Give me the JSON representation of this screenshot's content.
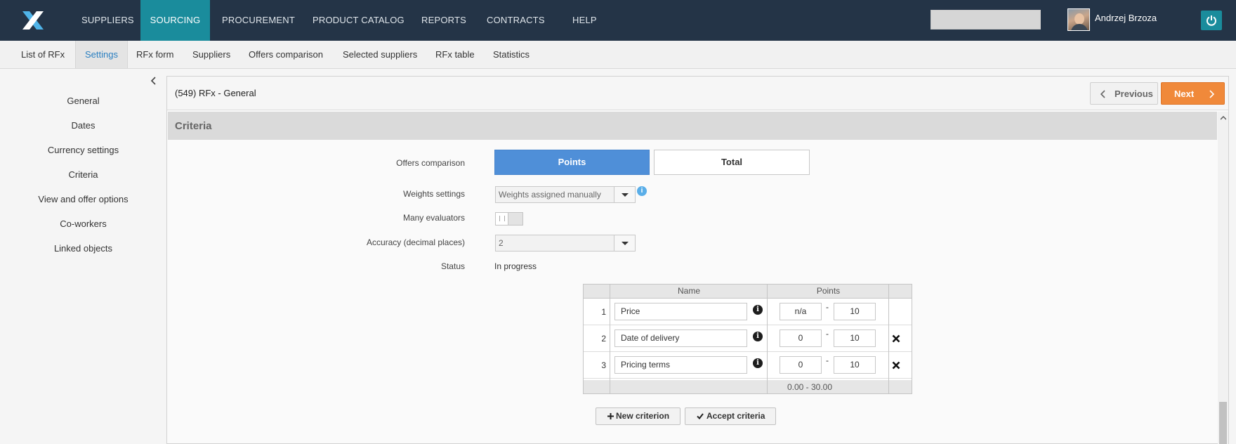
{
  "topnav": {
    "items": [
      "SUPPLIERS",
      "SOURCING",
      "PROCUREMENT",
      "PRODUCT CATALOG",
      "REPORTS",
      "CONTRACTS",
      "HELP"
    ],
    "active": "SOURCING",
    "user_name": "Andrzej Brzoza",
    "logo_icon": "x-logo-icon",
    "power_icon": "power-icon",
    "accent_color": "#1a8c9c"
  },
  "subnav": {
    "items": [
      "List of RFx",
      "Settings",
      "RFx form",
      "Suppliers",
      "Offers comparison",
      "Selected suppliers",
      "RFx table",
      "Statistics"
    ],
    "active": "Settings"
  },
  "sidebar": {
    "items": [
      "General",
      "Dates",
      "Currency settings",
      "Criteria",
      "View and offer options",
      "Co-workers",
      "Linked objects"
    ]
  },
  "panel": {
    "title": "(549) RFx - General",
    "prev_label": "Previous",
    "next_label": "Next",
    "section_title": "Criteria"
  },
  "form": {
    "offers_comparison_label": "Offers comparison",
    "offers_comparison_options": [
      "Points",
      "Total"
    ],
    "offers_comparison_selected": "Points",
    "weights_label": "Weights settings",
    "weights_value": "Weights assigned manually",
    "many_evaluators_label": "Many evaluators",
    "many_evaluators_on": false,
    "accuracy_label": "Accuracy (decimal places)",
    "accuracy_value": "2",
    "status_label": "Status",
    "status_value": "In progress"
  },
  "criteria_table": {
    "headers": [
      "Name",
      "Points"
    ],
    "rows": [
      {
        "num": "1",
        "name": "Price",
        "min": "n/a",
        "max": "10",
        "deletable": false
      },
      {
        "num": "2",
        "name": "Date of delivery",
        "min": "0",
        "max": "10",
        "deletable": true
      },
      {
        "num": "3",
        "name": "Pricing terms",
        "min": "0",
        "max": "10",
        "deletable": true
      }
    ],
    "dash": "-",
    "total_range": "0.00 - 30.00"
  },
  "actions": {
    "new_label": "New criterion",
    "accept_label": "Accept criteria"
  }
}
